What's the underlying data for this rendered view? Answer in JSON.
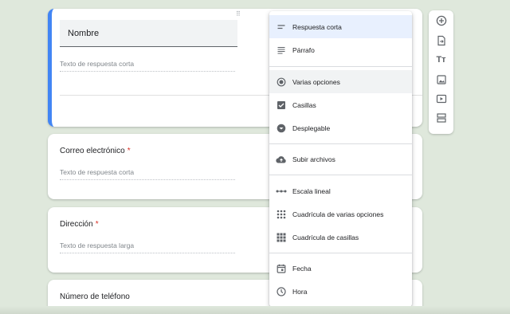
{
  "questions": [
    {
      "title": "Nombre",
      "answer_placeholder": "Texto de respuesta corta"
    },
    {
      "title": "Correo electrónico",
      "required_mark": "*",
      "answer_placeholder": "Texto de respuesta corta"
    },
    {
      "title": "Dirección",
      "required_mark": "*",
      "answer_placeholder": "Texto de respuesta larga"
    },
    {
      "title": "Número de teléfono"
    }
  ],
  "drag_handle": "⠿",
  "type_menu": {
    "items": [
      {
        "label": "Respuesta corta",
        "icon": "short-text-icon",
        "state": "selected"
      },
      {
        "label": "Párrafo",
        "icon": "paragraph-icon"
      },
      {
        "label": "Varias opciones",
        "icon": "radio-icon",
        "state": "hover"
      },
      {
        "label": "Casillas",
        "icon": "checkbox-icon"
      },
      {
        "label": "Desplegable",
        "icon": "dropdown-icon"
      },
      {
        "label": "Subir archivos",
        "icon": "cloud-upload-icon"
      },
      {
        "label": "Escala lineal",
        "icon": "linear-scale-icon"
      },
      {
        "label": "Cuadrícula de varias opciones",
        "icon": "grid-icon"
      },
      {
        "label": "Cuadrícula de casillas",
        "icon": "checkbox-grid-icon"
      },
      {
        "label": "Fecha",
        "icon": "calendar-icon"
      },
      {
        "label": "Hora",
        "icon": "clock-icon"
      }
    ]
  },
  "toolbar": {
    "buttons": [
      "add-question-icon",
      "import-questions-icon",
      "add-title-icon",
      "add-image-icon",
      "add-video-icon",
      "add-section-icon"
    ],
    "title_glyph": "Tт"
  },
  "colors": {
    "accent": "#4285f4",
    "required": "#d93025",
    "background": "#dfe8dc",
    "selected": "#e8f0fe"
  }
}
